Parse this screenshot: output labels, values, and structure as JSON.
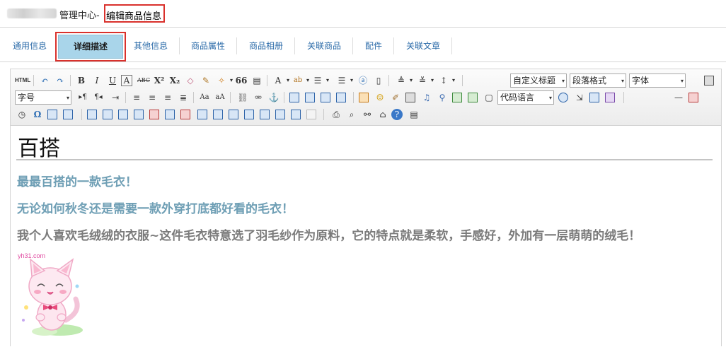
{
  "header": {
    "breadcrumb_prefix": "管理中心-",
    "current_page": "编辑商品信息"
  },
  "tabs": {
    "items": [
      "通用信息",
      "详细描述",
      "其他信息",
      "商品属性",
      "商品相册",
      "关联商品",
      "配件",
      "关联文章"
    ],
    "active_index": 1
  },
  "toolbar": {
    "html_label": "HTML",
    "custom_heading": "自定义标题",
    "paragraph_format": "段落格式",
    "font_family": "字体",
    "font_size": "字号",
    "code_language": "代码语言",
    "quote_label": "66"
  },
  "content": {
    "heading": "百搭",
    "line1": "最最百搭的一款毛衣！",
    "line2": "无论如何秋冬还是需要一款外穿打底都好看的毛衣！",
    "line3": "我个人喜欢毛绒绒的衣服~这件毛衣特意选了羽毛纱作为原料，它的特点就是柔软，手感好，外加有一层萌萌的绒毛！",
    "image_watermark": "yh31.com",
    "colors": {
      "accent_text": "#6f9fb5",
      "grey_text": "#7b7b7b",
      "active_tab": "#a9d5ea",
      "highlight_border": "#d9312c"
    }
  }
}
